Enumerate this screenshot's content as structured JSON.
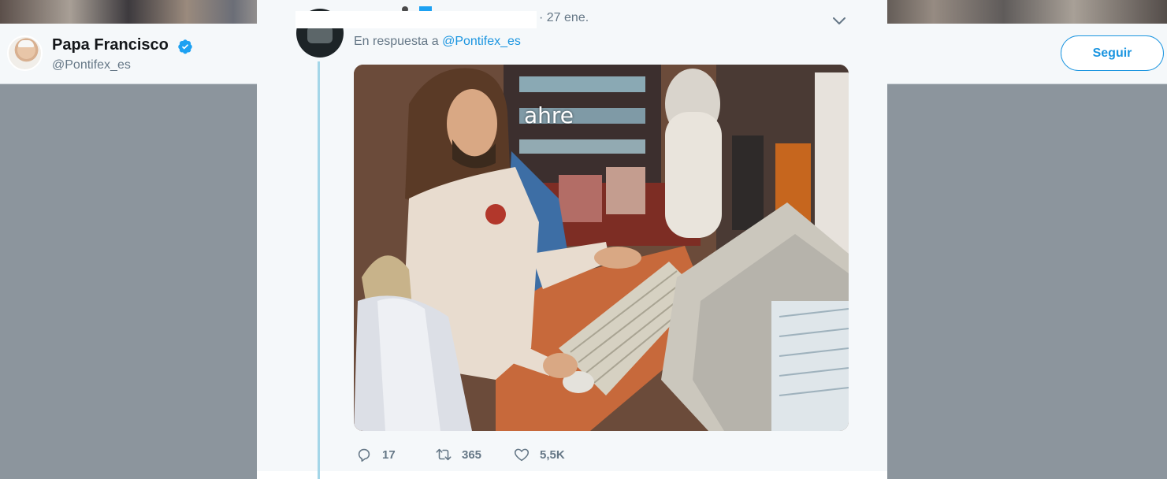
{
  "profile": {
    "name": "Papa Francisco",
    "handle": "@Pontifex_es",
    "follow_label": "Seguir"
  },
  "tweet": {
    "date": "· 27 ene.",
    "reply_prefix": "En respuesta a ",
    "reply_handle": "@Pontifex_es",
    "image_caption": "ahre",
    "stats": {
      "replies": "17",
      "retweets": "365",
      "likes": "5,5K"
    }
  },
  "colors": {
    "accent": "#1b95e0",
    "verified": "#1da1f2",
    "muted_text": "#657786",
    "thread_line": "#a4d6e8"
  },
  "icons": {
    "verified": "verified-badge-icon",
    "caret": "chevron-down-icon",
    "reply": "reply-icon",
    "retweet": "retweet-icon",
    "like": "heart-icon"
  }
}
